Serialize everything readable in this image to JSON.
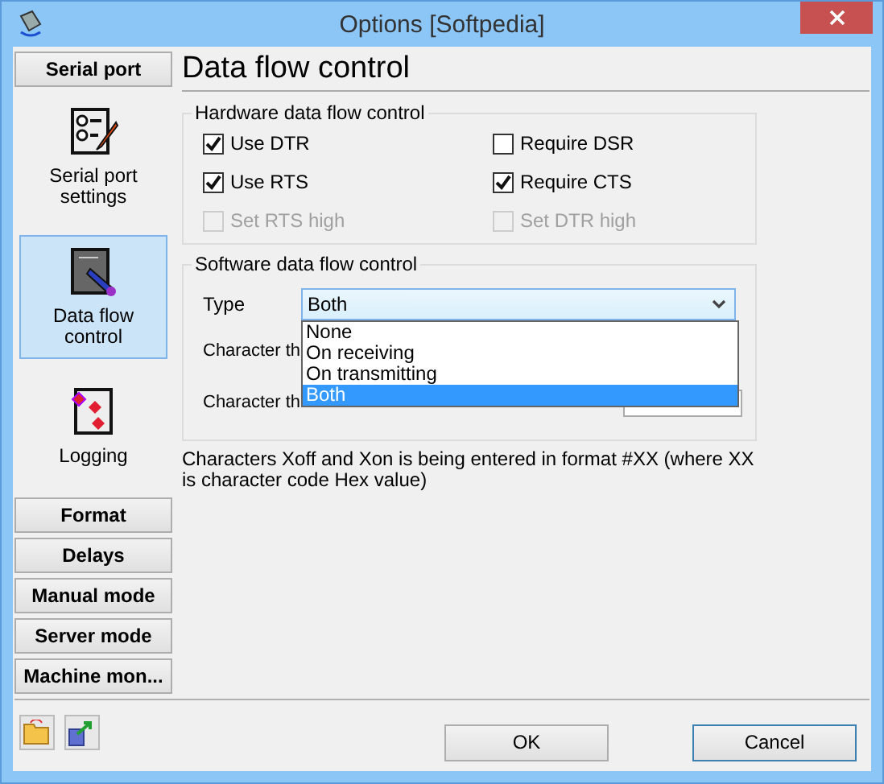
{
  "window": {
    "title": "Options [Softpedia]"
  },
  "sidebar": {
    "top_button": "Serial port",
    "items": [
      {
        "label": "Serial port settings",
        "selected": false
      },
      {
        "label": "Data flow control",
        "selected": true
      },
      {
        "label": "Logging",
        "selected": false
      }
    ],
    "buttons": [
      "Format",
      "Delays",
      "Manual mode",
      "Server mode",
      "Machine mon..."
    ]
  },
  "page": {
    "heading": "Data flow control",
    "hardware": {
      "title": "Hardware data flow control",
      "options": [
        {
          "label": "Use DTR",
          "checked": true,
          "disabled": false
        },
        {
          "label": "Require DSR",
          "checked": false,
          "disabled": false
        },
        {
          "label": "Use RTS",
          "checked": true,
          "disabled": false
        },
        {
          "label": "Require CTS",
          "checked": true,
          "disabled": false
        },
        {
          "label": "Set RTS high",
          "checked": false,
          "disabled": true
        },
        {
          "label": "Set DTR high",
          "checked": false,
          "disabled": true
        }
      ]
    },
    "software": {
      "title": "Software data flow control",
      "type_label": "Type",
      "type_value": "Both",
      "type_options": [
        {
          "label": "None",
          "selected": false
        },
        {
          "label": "On receiving",
          "selected": false
        },
        {
          "label": "On transmitting",
          "selected": false
        },
        {
          "label": "Both",
          "selected": true
        }
      ],
      "rows": [
        {
          "label": "Character th"
        },
        {
          "label": "Character th"
        }
      ]
    },
    "note": "Characters Xoff and Xon is being entered in format #XX (where XX is character code Hex value)"
  },
  "footer": {
    "buttons": [
      {
        "label": "OK",
        "focused": false
      },
      {
        "label": "Cancel",
        "focused": true
      }
    ]
  }
}
